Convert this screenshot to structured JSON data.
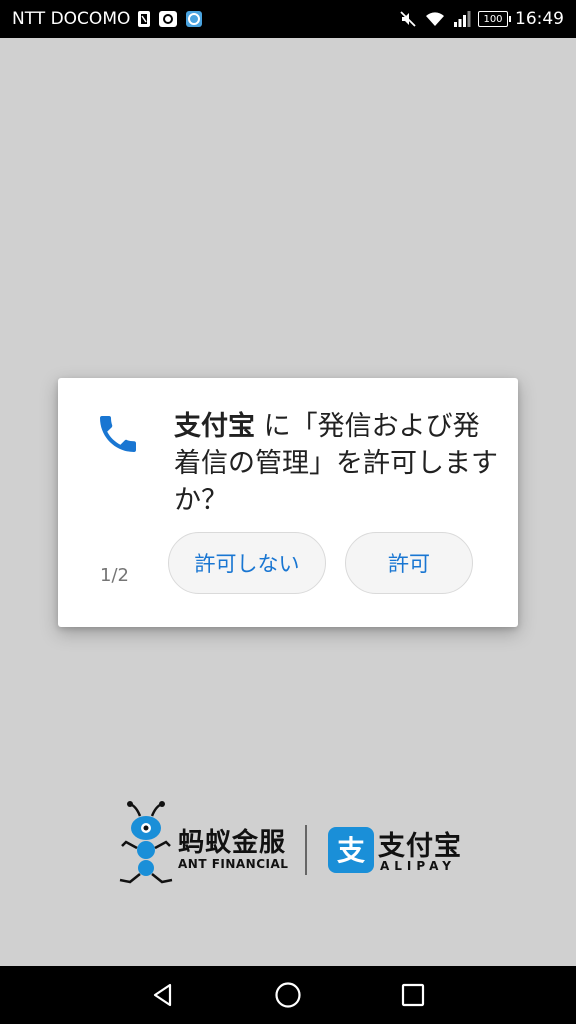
{
  "status_bar": {
    "carrier": "NTT DOCOMO",
    "left_icons": [
      "sim-notification-icon",
      "camera-notification-icon",
      "sync-notification-icon"
    ],
    "right_icons": [
      "mute-icon",
      "wifi-icon",
      "signal-icon"
    ],
    "battery": "100",
    "time": "16:49"
  },
  "dialog": {
    "icon": "phone-icon",
    "icon_color": "#1976d2",
    "app_name": "支付宝",
    "message": " に「発信および発着信の管理」を許可しますか？",
    "page_indicator": "1/2",
    "deny_label": "許可しない",
    "allow_label": "許可"
  },
  "branding": {
    "ant_name_cn": "蚂蚁金服",
    "ant_name_en": "ANT FINANCIAL",
    "alipay_name_cn": "支付宝",
    "alipay_name_en": "ALIPAY",
    "alipay_logo_char": "支",
    "brand_color": "#1a8fd8"
  },
  "nav_bar": {
    "buttons": [
      "back-icon",
      "home-icon",
      "recents-icon"
    ]
  }
}
